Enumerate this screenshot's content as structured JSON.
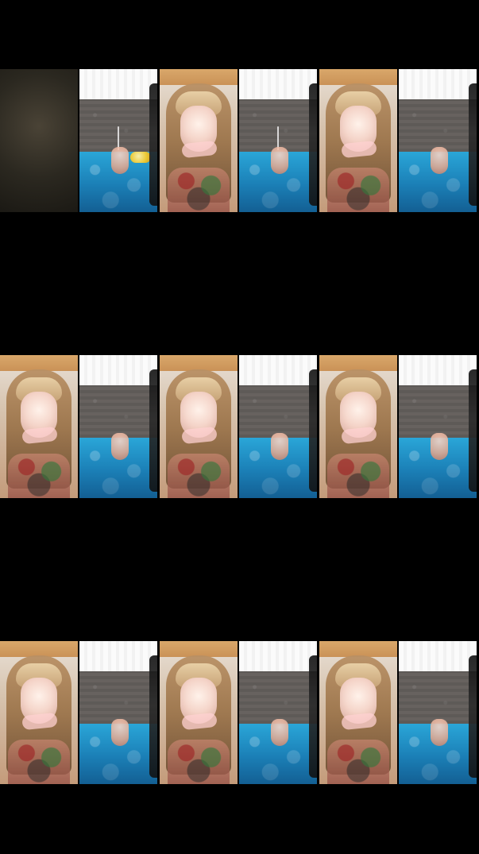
{
  "screen": {
    "background_color": "#000000"
  },
  "frames": [
    {
      "name": "frame-1",
      "left_variant": "dark",
      "pool_variant": "fountain-float"
    },
    {
      "name": "frame-2",
      "left_variant": "selfie",
      "pool_variant": "fountain"
    },
    {
      "name": "frame-3",
      "left_variant": "selfie",
      "pool_variant": "standard"
    },
    {
      "name": "frame-4",
      "left_variant": "selfie",
      "pool_variant": "standard"
    },
    {
      "name": "frame-5",
      "left_variant": "selfie",
      "pool_variant": "standard"
    },
    {
      "name": "frame-6",
      "left_variant": "selfie",
      "pool_variant": "standard"
    },
    {
      "name": "frame-7",
      "left_variant": "selfie",
      "pool_variant": "standard"
    },
    {
      "name": "frame-8",
      "left_variant": "selfie",
      "pool_variant": "standard"
    },
    {
      "name": "frame-9",
      "left_variant": "selfie",
      "pool_variant": "standard"
    }
  ],
  "colors": {
    "water": "#1b7fb6",
    "wall": "#5e5a57",
    "ceiling": "#f6f6f6"
  }
}
